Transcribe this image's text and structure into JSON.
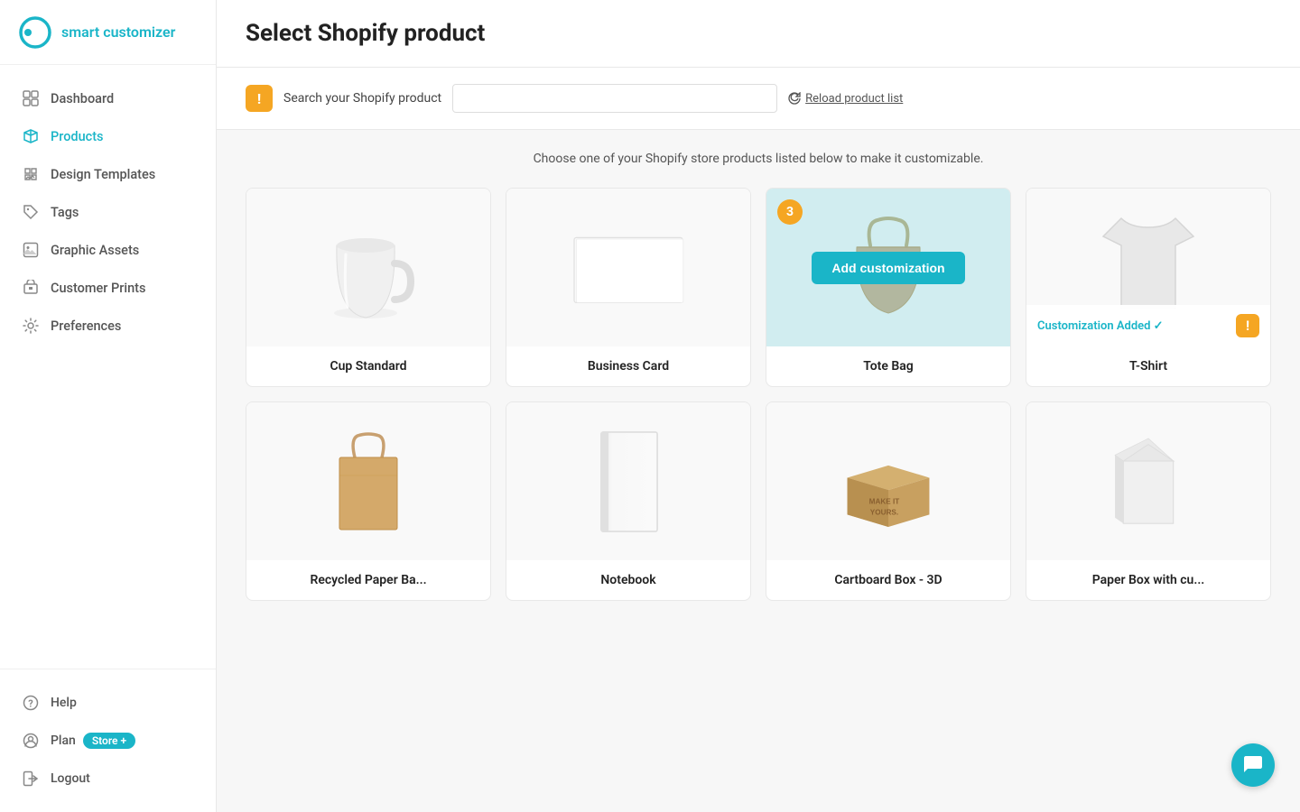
{
  "app": {
    "name": "smart customizer",
    "logo_alt": "Smart Customizer Logo"
  },
  "sidebar": {
    "nav_items": [
      {
        "id": "dashboard",
        "label": "Dashboard",
        "icon": "dashboard-icon"
      },
      {
        "id": "products",
        "label": "Products",
        "icon": "products-icon",
        "active": true
      },
      {
        "id": "design-templates",
        "label": "Design Templates",
        "icon": "design-templates-icon"
      },
      {
        "id": "tags",
        "label": "Tags",
        "icon": "tags-icon"
      },
      {
        "id": "graphic-assets",
        "label": "Graphic Assets",
        "icon": "graphic-assets-icon"
      },
      {
        "id": "customer-prints",
        "label": "Customer Prints",
        "icon": "customer-prints-icon"
      },
      {
        "id": "preferences",
        "label": "Preferences",
        "icon": "preferences-icon"
      }
    ],
    "bottom_items": [
      {
        "id": "help",
        "label": "Help",
        "icon": "help-icon"
      },
      {
        "id": "plan",
        "label": "Plan",
        "icon": "plan-icon",
        "badge": "Store +"
      },
      {
        "id": "logout",
        "label": "Logout",
        "icon": "logout-icon"
      }
    ]
  },
  "main": {
    "title": "Select Shopify product",
    "search_label": "Search your Shopify product",
    "search_placeholder": "",
    "reload_label": "Reload product list",
    "subtitle": "Choose one of your Shopify store products listed below to make it customizable.",
    "products": [
      {
        "id": "cup-standard",
        "name": "Cup Standard",
        "type": "mug",
        "has_overlay": false,
        "customization_added": false
      },
      {
        "id": "business-card",
        "name": "Business Card",
        "type": "bcard",
        "has_overlay": false,
        "customization_added": false
      },
      {
        "id": "tote-bag",
        "name": "Tote Bag",
        "type": "tote",
        "has_overlay": true,
        "overlay_count": 3,
        "add_btn_label": "Add customization",
        "customization_added": false
      },
      {
        "id": "tshirt",
        "name": "T-Shirt",
        "type": "tshirt",
        "has_overlay": false,
        "customization_added": true,
        "customization_added_text": "Customization Added ✓"
      },
      {
        "id": "recycled-paper-bag",
        "name": "Recycled Paper Ba...",
        "type": "paperbag",
        "has_overlay": false,
        "customization_added": false
      },
      {
        "id": "notebook",
        "name": "Notebook",
        "type": "notebook",
        "has_overlay": false,
        "customization_added": false
      },
      {
        "id": "cartboard-box",
        "name": "Cartboard Box - 3D",
        "type": "cbox",
        "has_overlay": false,
        "customization_added": false
      },
      {
        "id": "paper-box",
        "name": "Paper Box with cu...",
        "type": "pbox",
        "has_overlay": false,
        "customization_added": false
      }
    ]
  }
}
